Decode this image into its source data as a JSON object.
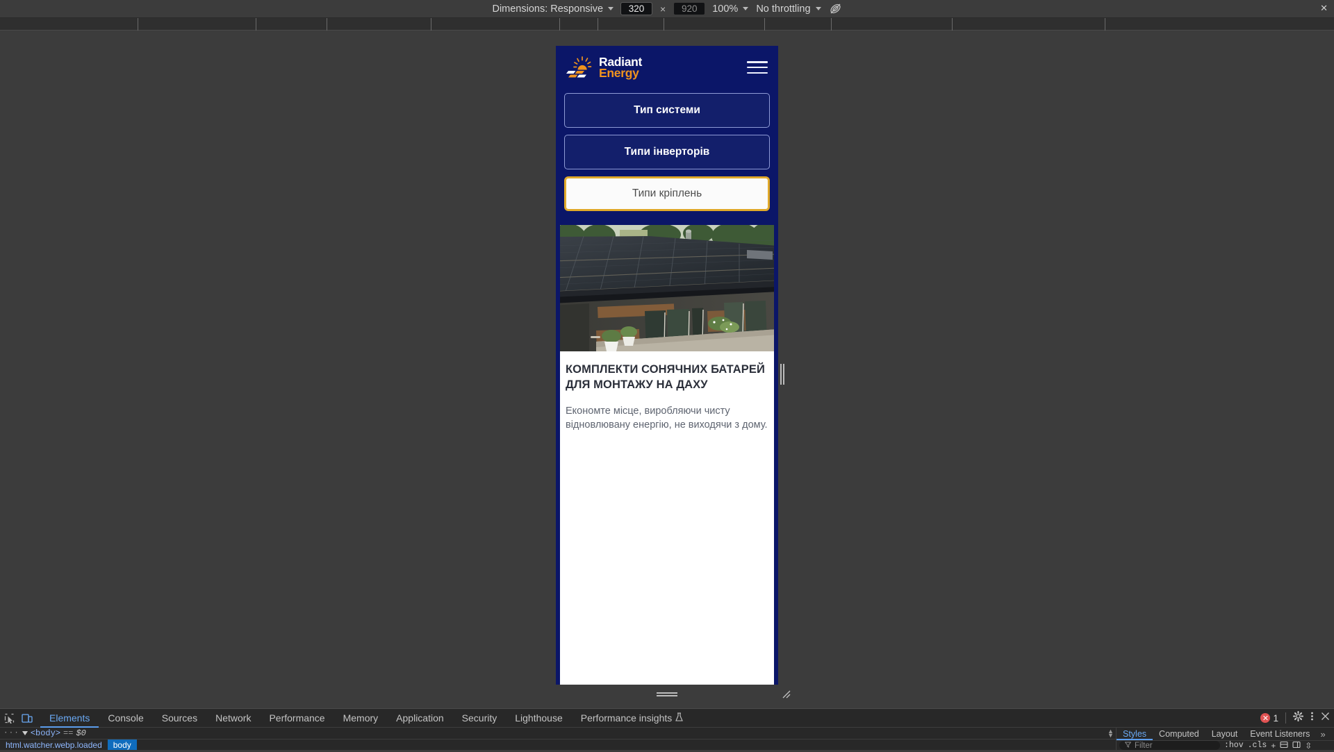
{
  "device_toolbar": {
    "dimensions_label": "Dimensions: Responsive",
    "width_value": "320",
    "height_value": "920",
    "height_placeholder": "920",
    "multiply_symbol": "×",
    "zoom_value": "100%",
    "throttling_value": "No throttling",
    "throttle_icon": "no-throttling-icon",
    "close_label": "✕"
  },
  "page": {
    "logo": {
      "line1": "Radiant",
      "line2": "Energy",
      "mark": "sun-solar-panel-icon"
    },
    "menu_icon": "hamburger-menu-icon",
    "nav_buttons": [
      {
        "label": "Тип системи",
        "active": false
      },
      {
        "label": "Типи інверторів",
        "active": false
      },
      {
        "label": "Типи кріплень",
        "active": true
      }
    ],
    "hero": {
      "image_alt": "modern-house-with-rooftop-solar-panels",
      "title": "КОМПЛЕКТИ СОНЯЧНИХ БАТАРЕЙ ДЛЯ МОНТАЖУ НА ДАХУ",
      "subtitle": "Економте місце, виробляючи чисту відновлювану енергію, не виходячи з дому."
    },
    "colors": {
      "brand_navy": "#0b1668",
      "brand_orange": "#f0931e",
      "active_border": "#e0a92a"
    }
  },
  "devtools": {
    "tabs": [
      {
        "label": "Elements",
        "active": true
      },
      {
        "label": "Console",
        "active": false
      },
      {
        "label": "Sources",
        "active": false
      },
      {
        "label": "Network",
        "active": false
      },
      {
        "label": "Performance",
        "active": false
      },
      {
        "label": "Memory",
        "active": false
      },
      {
        "label": "Application",
        "active": false
      },
      {
        "label": "Security",
        "active": false
      },
      {
        "label": "Lighthouse",
        "active": false
      },
      {
        "label": "Performance insights",
        "active": false,
        "icon": "flask-icon"
      }
    ],
    "inspect_icon": "inspect-element-icon",
    "device_toggle_icon": "device-toolbar-icon",
    "error_count": "1",
    "settings_icon": "gear-icon",
    "more_icon": "kebab-menu-icon",
    "close_icon": "close-icon",
    "dom": {
      "dots": "···",
      "tag": "<body>",
      "equals": "==",
      "selection": "$0"
    },
    "breadcrumbs": [
      {
        "label": "html.watcher.webp.loaded",
        "active": false
      },
      {
        "label": "body",
        "active": true
      }
    ],
    "styles": {
      "tabs": [
        {
          "label": "Styles",
          "active": true
        },
        {
          "label": "Computed",
          "active": false
        },
        {
          "label": "Layout",
          "active": false
        },
        {
          "label": "Event Listeners",
          "active": false
        }
      ],
      "more": "»",
      "filter_placeholder": "Filter",
      "filter_icon": "funnel-icon",
      "hov": ":hov",
      "cls": ".cls",
      "plus": "+",
      "new_style_icon": "new-style-rule-icon",
      "toggle_icon": "computed-sidebar-icon"
    }
  }
}
